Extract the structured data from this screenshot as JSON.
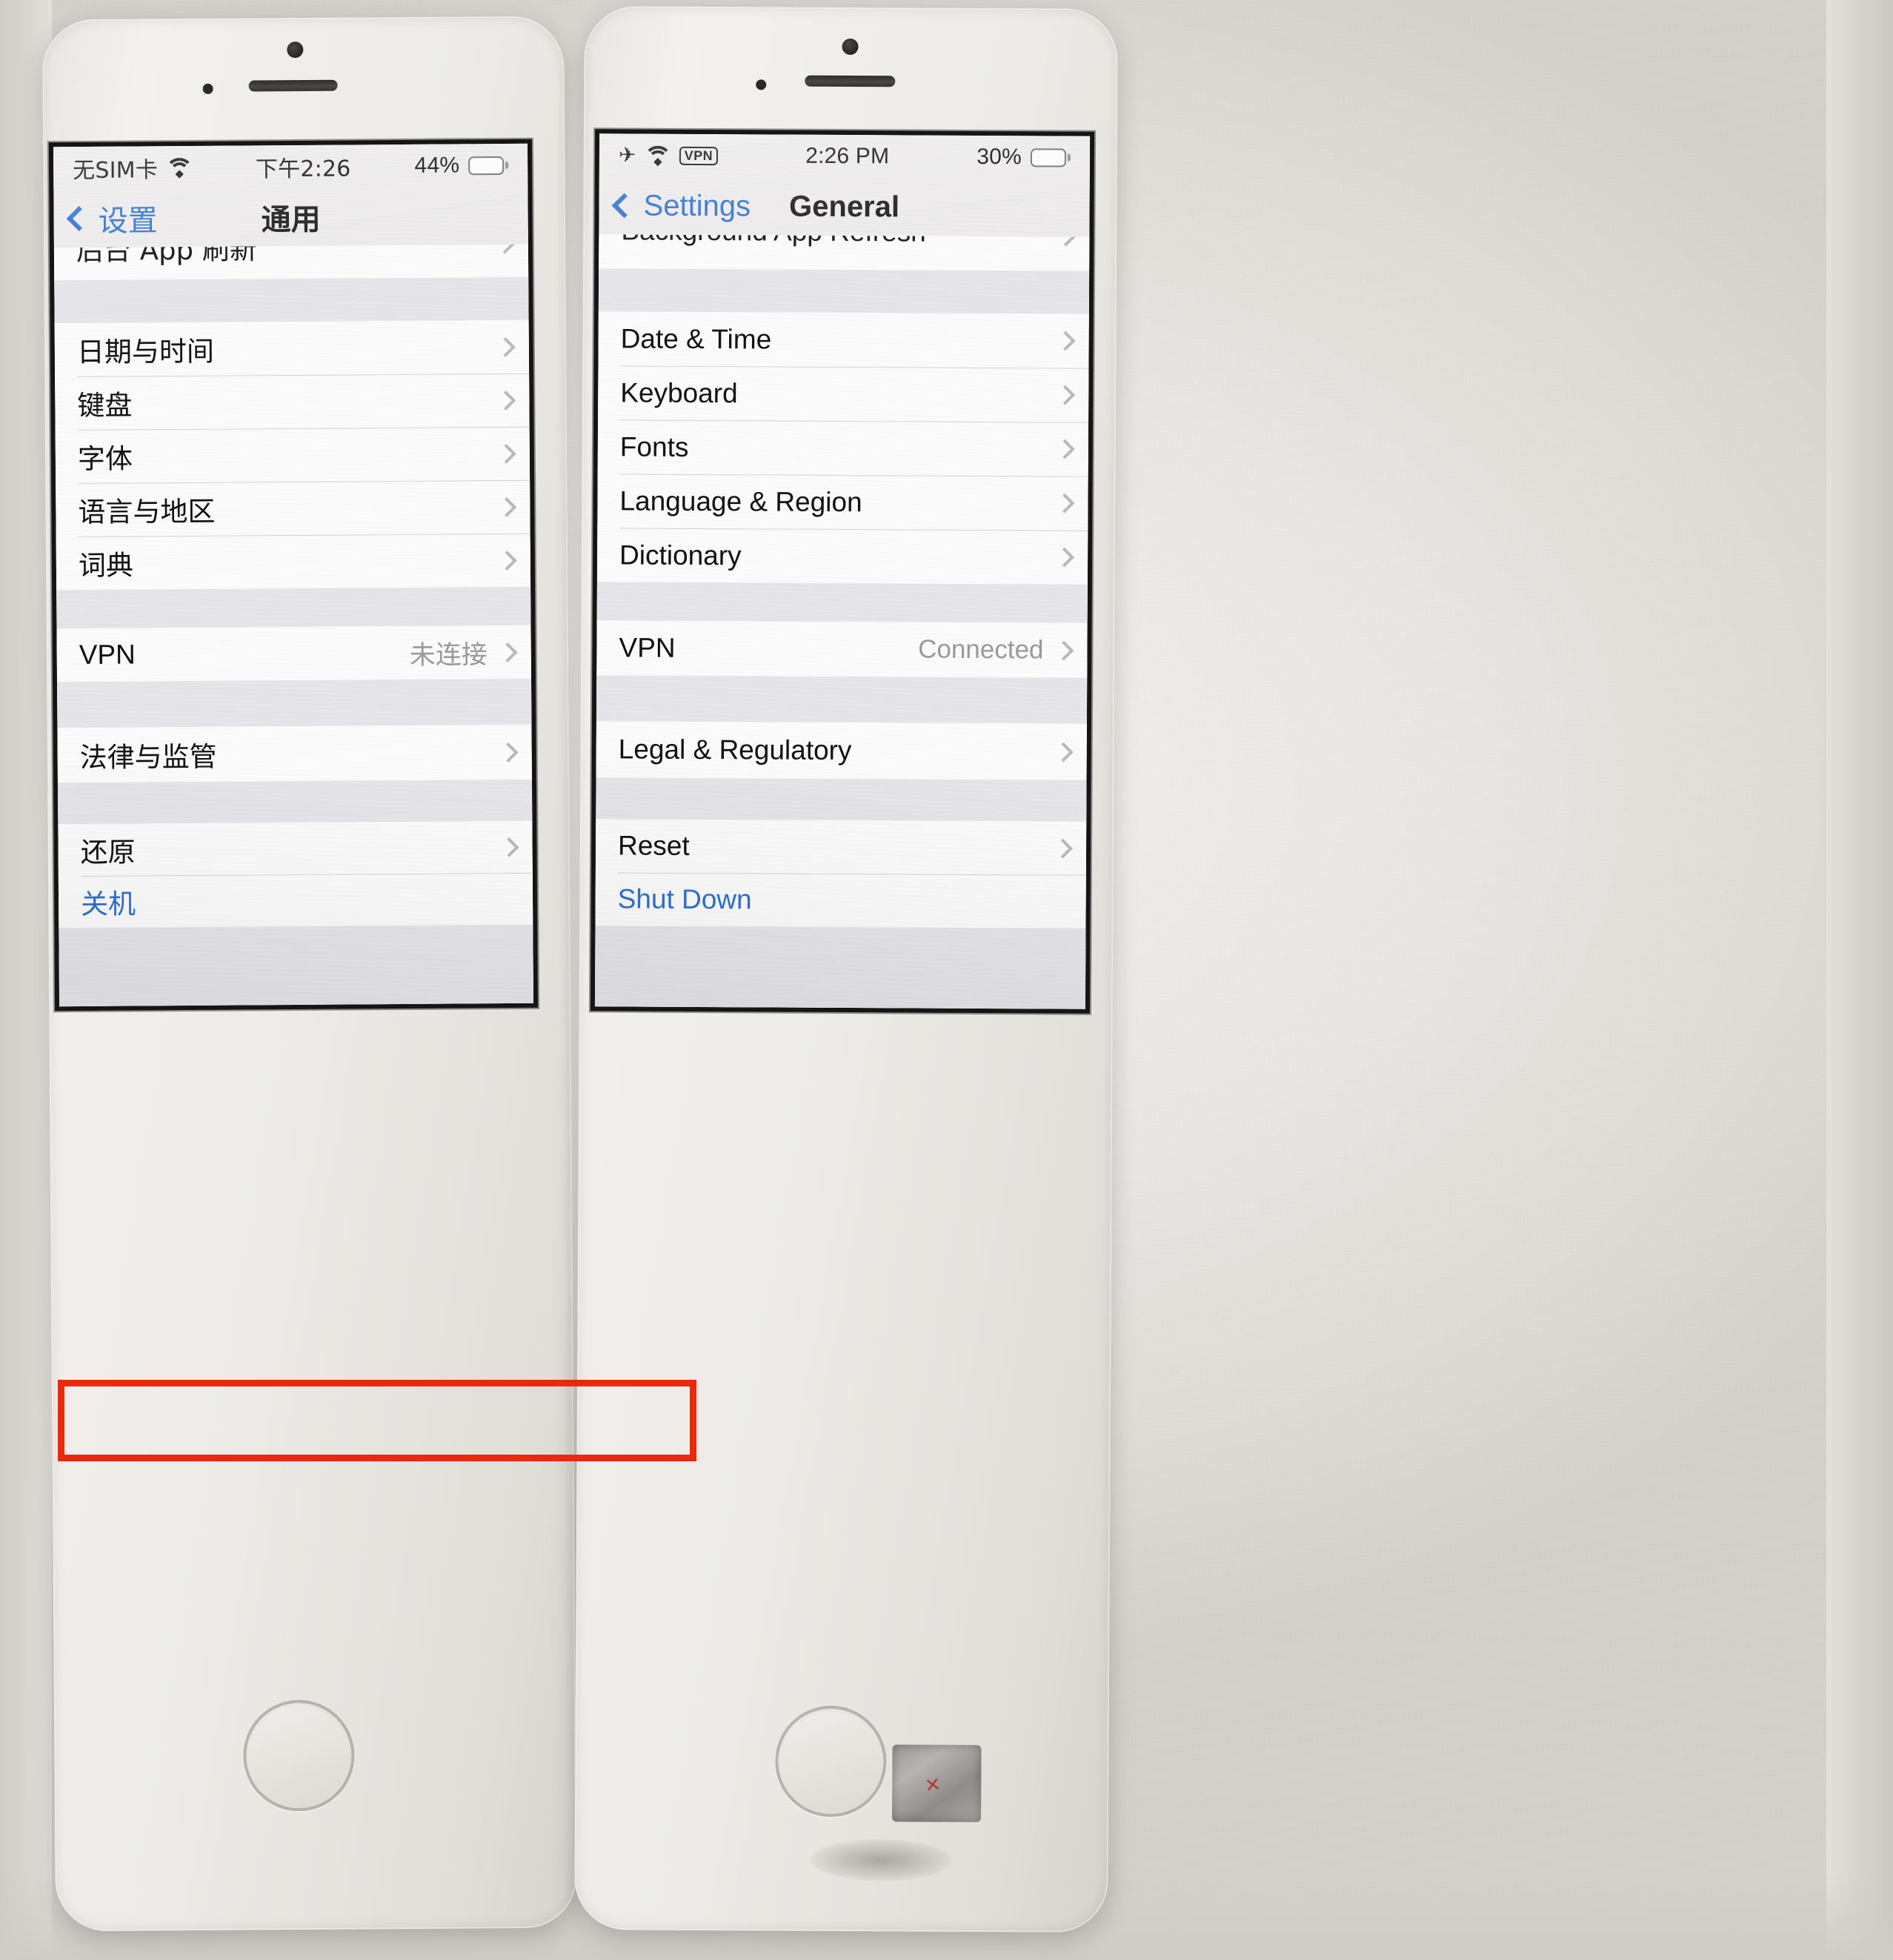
{
  "scene": {
    "description": "Two iPhones side by side showing the iOS Settings > General screen, left in Chinese and right in English, with the Reset row highlighted by a red annotation box",
    "annotation_color": "#e8290b"
  },
  "phone_left": {
    "language": "zh-Hans",
    "status_bar": {
      "carrier": "无SIM卡",
      "wifi_icon": "wifi-icon",
      "time": "下午2:26",
      "battery_percent": "44%",
      "battery_level": 44,
      "battery_color": "#f3b70f"
    },
    "nav": {
      "back_label": "设置",
      "back_icon": "chevron-left-icon",
      "title": "通用"
    },
    "rows": [
      {
        "label": "后台 App 刷新",
        "value": "",
        "clipped": true,
        "blue": false
      },
      {
        "label": "日期与时间",
        "value": "",
        "clipped": false,
        "blue": false
      },
      {
        "label": "键盘",
        "value": "",
        "clipped": false,
        "blue": false
      },
      {
        "label": "字体",
        "value": "",
        "clipped": false,
        "blue": false
      },
      {
        "label": "语言与地区",
        "value": "",
        "clipped": false,
        "blue": false
      },
      {
        "label": "词典",
        "value": "",
        "clipped": false,
        "blue": false
      },
      {
        "label": "VPN",
        "value": "未连接",
        "clipped": false,
        "blue": false
      },
      {
        "label": "法律与监管",
        "value": "",
        "clipped": false,
        "blue": false
      },
      {
        "label": "还原",
        "value": "",
        "clipped": false,
        "blue": false
      },
      {
        "label": "关机",
        "value": "",
        "clipped": false,
        "blue": true
      }
    ]
  },
  "phone_right": {
    "language": "en",
    "status_bar": {
      "airplane_icon": "airplane-mode-icon",
      "wifi_icon": "wifi-icon",
      "vpn_badge": "VPN",
      "time": "2:26 PM",
      "battery_percent": "30%",
      "battery_level": 30,
      "battery_color": "#f3b70f"
    },
    "nav": {
      "back_label": "Settings",
      "back_icon": "chevron-left-icon",
      "title": "General"
    },
    "rows": [
      {
        "label": "Background App Refresh",
        "value": "",
        "clipped": true,
        "blue": false
      },
      {
        "label": "Date & Time",
        "value": "",
        "clipped": false,
        "blue": false
      },
      {
        "label": "Keyboard",
        "value": "",
        "clipped": false,
        "blue": false
      },
      {
        "label": "Fonts",
        "value": "",
        "clipped": false,
        "blue": false
      },
      {
        "label": "Language & Region",
        "value": "",
        "clipped": false,
        "blue": false
      },
      {
        "label": "Dictionary",
        "value": "",
        "clipped": false,
        "blue": false
      },
      {
        "label": "VPN",
        "value": "Connected",
        "clipped": false,
        "blue": false
      },
      {
        "label": "Legal & Regulatory",
        "value": "",
        "clipped": false,
        "blue": false
      },
      {
        "label": "Reset",
        "value": "",
        "clipped": false,
        "blue": false
      },
      {
        "label": "Shut Down",
        "value": "",
        "clipped": false,
        "blue": true
      }
    ]
  }
}
